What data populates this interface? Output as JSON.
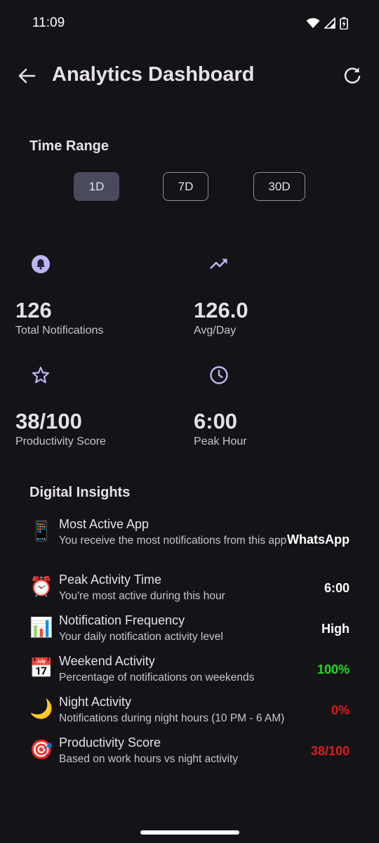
{
  "status_bar": {
    "time": "11:09"
  },
  "header": {
    "title": "Analytics Dashboard",
    "back_icon": "arrow-left-icon",
    "refresh_icon": "refresh-icon"
  },
  "time_range": {
    "title": "Time Range",
    "options": [
      "1D",
      "7D",
      "30D"
    ],
    "selected": "1D"
  },
  "stats": [
    {
      "icon": "bell-icon",
      "value": "126",
      "label": "Total Notifications"
    },
    {
      "icon": "trending-up-icon",
      "value": "126.0",
      "label": "Avg/Day"
    },
    {
      "icon": "star-icon",
      "value": "38/100",
      "label": "Productivity Score"
    },
    {
      "icon": "clock-icon",
      "value": "6:00",
      "label": "Peak Hour"
    }
  ],
  "insights_section": {
    "title": "Digital Insights",
    "items": [
      {
        "emoji": "📱",
        "title": "Most Active App",
        "description": "You receive the most notifications from this app",
        "value": "WhatsApp",
        "value_color": "#ffffff"
      },
      {
        "emoji": "⏰",
        "title": "Peak Activity Time",
        "description": "You're most active during this hour",
        "value": "6:00",
        "value_color": "#ffffff"
      },
      {
        "emoji": "📊",
        "title": "Notification Frequency",
        "description": "Your daily notification activity level",
        "value": "High",
        "value_color": "#ffffff"
      },
      {
        "emoji": "📅",
        "title": "Weekend Activity",
        "description": "Percentage of notifications on weekends",
        "value": "100%",
        "value_color": "#22dd22"
      },
      {
        "emoji": "🌙",
        "title": "Night Activity",
        "description": "Notifications during night hours (10 PM - 6 AM)",
        "value": "0%",
        "value_color": "#e01b1b"
      },
      {
        "emoji": "🎯",
        "title": "Productivity Score",
        "description": "Based on work hours vs night activity",
        "value": "38/100",
        "value_color": "#e01b1b"
      }
    ]
  },
  "colors": {
    "background": "#141318",
    "accent": "#b9b6f4",
    "selected_chip": "#4a4a5e"
  }
}
